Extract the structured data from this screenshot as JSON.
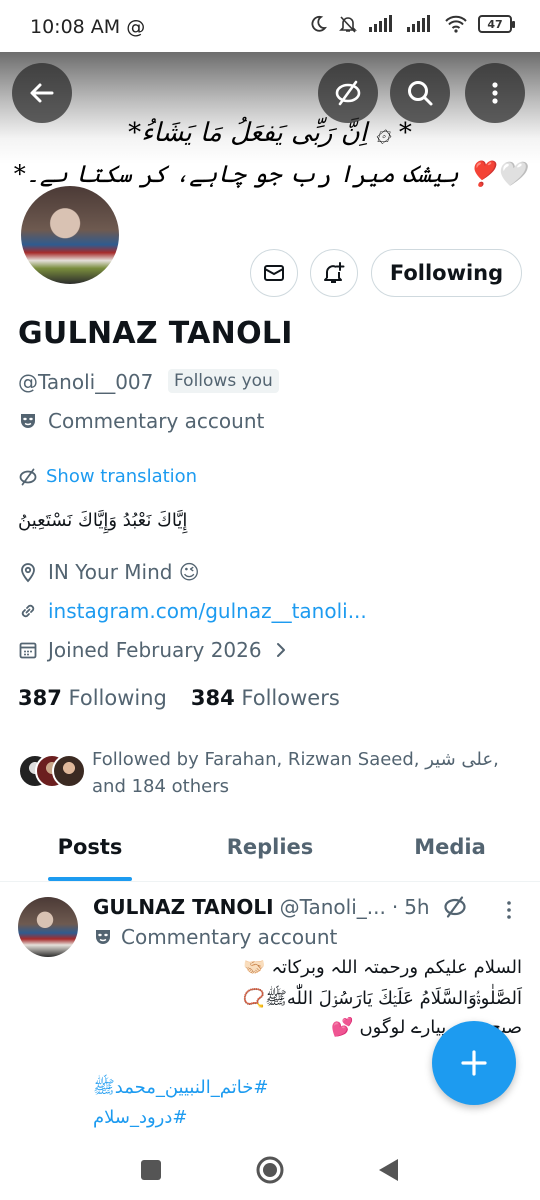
{
  "status_bar": {
    "time": "10:08 AM",
    "at_symbol": "@",
    "battery": "47"
  },
  "banner": {
    "line1": "*اِنَّ رَبِّی یَفعَلُ مَا یَشَاءُ ۞ *",
    "line2": "*بیشک میرا رب جو چاہے، کر سکتا ہے۔",
    "hearts": "❣️🤍"
  },
  "profile": {
    "name": "GULNAZ TANOLI",
    "handle": "@Tanoli__007",
    "follows_you": "Follows you",
    "commentary": "Commentary account",
    "show_translation": "Show translation",
    "bio": "إِيَّاكَ نَعْبُدُ وَإِيَّاكَ نَسْتَعِينُ",
    "location": "IN Your Mind 😉",
    "link": "instagram.com/gulnaz__tanoli...",
    "joined": "Joined February 2026",
    "following_count": "387",
    "following_label": "Following",
    "followers_count": "384",
    "followers_label": "Followers",
    "followed_by": "Followed by Farahan, Rizwan Saeed, علی شیر, and 184 others",
    "following_button": "Following"
  },
  "tabs": [
    {
      "label": "Posts"
    },
    {
      "label": "Replies"
    },
    {
      "label": "Media"
    }
  ],
  "post": {
    "author": "GULNAZ TANOLI",
    "handle": "@Tanoli_...",
    "dot": "·",
    "time": "5h",
    "commentary": "Commentary account",
    "line1": "السلام علیکم ورحمتہ اللہ وبرکاتہ 🤝🏻",
    "line2": "اَلصَّلٰوۃُوَالسَّلَامُ عَلَیۡكَ یَارَسُوۡلَ اللّٰهﷺ📿",
    "line3": "صبح بخیر پیارے لوگوں 💕",
    "hashtag1": "#خاتم_النبیین_محمدﷺ",
    "hashtag2": "#درود_سلام"
  },
  "colors": {
    "accent": "#1d9bf0",
    "text": "#0f1419",
    "muted": "#536471",
    "border": "#cfd9de"
  }
}
